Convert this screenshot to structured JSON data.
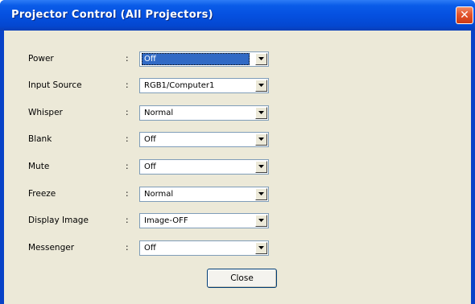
{
  "window": {
    "title": "Projector Control (All Projectors)",
    "close_glyph": "✕",
    "close_icon": "close-icon"
  },
  "controls": [
    {
      "label": "Power",
      "colon": ":",
      "value": "Off",
      "selected": true
    },
    {
      "label": "Input Source",
      "colon": ":",
      "value": "RGB1/Computer1",
      "selected": false
    },
    {
      "label": "Whisper",
      "colon": ":",
      "value": "Normal",
      "selected": false
    },
    {
      "label": "Blank",
      "colon": ":",
      "value": "Off",
      "selected": false
    },
    {
      "label": "Mute",
      "colon": ":",
      "value": "Off",
      "selected": false
    },
    {
      "label": "Freeze",
      "colon": ":",
      "value": "Normal",
      "selected": false
    },
    {
      "label": "Display Image",
      "colon": ":",
      "value": "Image-OFF",
      "selected": false
    },
    {
      "label": "Messenger",
      "colon": ":",
      "value": "Off",
      "selected": false
    }
  ],
  "buttons": {
    "close_label": "Close"
  },
  "colors": {
    "titlebar": "#0550e0",
    "dialog_background": "#ece9d8",
    "selection_highlight": "#316ac5",
    "close_icon_bg": "#e2542c"
  }
}
